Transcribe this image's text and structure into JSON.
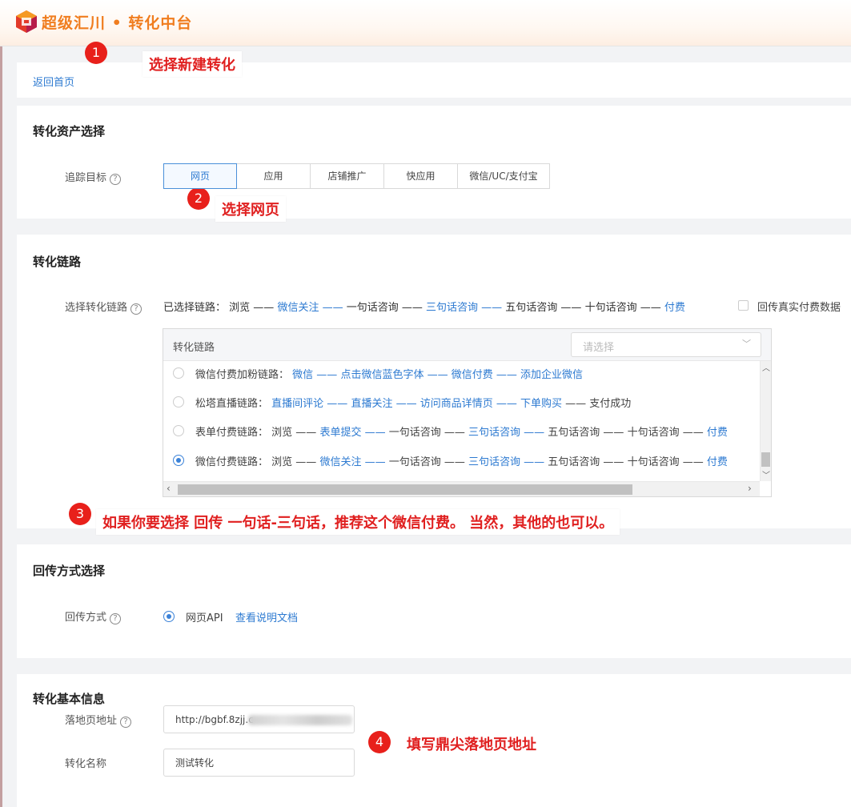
{
  "header": {
    "app_title": "超级汇川 • 转化中台"
  },
  "nav": {
    "back": "返回首页"
  },
  "asset": {
    "title": "转化资产选择",
    "track_label": "追踪目标",
    "help": "?",
    "options": [
      "网页",
      "应用",
      "店铺推广",
      "快应用",
      "微信/UC/支付宝"
    ],
    "selected": "网页"
  },
  "chain": {
    "title": "转化链路",
    "select_label": "选择转化链路",
    "help": "?",
    "selected_prefix": "已选择链路：",
    "selected_steps": [
      {
        "text": "浏览",
        "blue": false
      },
      {
        "text": " —— ",
        "blue": false
      },
      {
        "text": "微信关注",
        "blue": true
      },
      {
        "text": " —— ",
        "blue": true
      },
      {
        "text": "一句话咨询",
        "blue": false
      },
      {
        "text": " —— ",
        "blue": false
      },
      {
        "text": "三句话咨询",
        "blue": true
      },
      {
        "text": " —— ",
        "blue": true
      },
      {
        "text": "五句话咨询",
        "blue": false
      },
      {
        "text": " —— ",
        "blue": false
      },
      {
        "text": "十句话咨询",
        "blue": false
      },
      {
        "text": " —— ",
        "blue": false
      },
      {
        "text": "付费",
        "blue": true
      }
    ],
    "checkbox_label": "回传真实付费数据",
    "box_header": "转化链路",
    "select_placeholder": "请选择",
    "rows": [
      {
        "name": "微信付费加粉链路：",
        "checked": false,
        "steps": [
          {
            "text": "微信",
            "blue": true
          },
          {
            "text": " —— ",
            "blue": true
          },
          {
            "text": "点击微信蓝色字体",
            "blue": true
          },
          {
            "text": " —— ",
            "blue": true
          },
          {
            "text": "微信付费",
            "blue": true
          },
          {
            "text": " —— ",
            "blue": true
          },
          {
            "text": "添加企业微信",
            "blue": true
          }
        ]
      },
      {
        "name": "松塔直播链路：",
        "checked": false,
        "steps": [
          {
            "text": "直播间评论",
            "blue": true
          },
          {
            "text": " —— ",
            "blue": true
          },
          {
            "text": "直播关注",
            "blue": true
          },
          {
            "text": " —— ",
            "blue": true
          },
          {
            "text": "访问商品详情页",
            "blue": true
          },
          {
            "text": " —— ",
            "blue": true
          },
          {
            "text": "下单购买",
            "blue": true
          },
          {
            "text": " —— ",
            "blue": false
          },
          {
            "text": "支付成功",
            "blue": false
          }
        ]
      },
      {
        "name": "表单付费链路：",
        "checked": false,
        "steps": [
          {
            "text": "浏览",
            "blue": false
          },
          {
            "text": " —— ",
            "blue": false
          },
          {
            "text": "表单提交",
            "blue": true
          },
          {
            "text": " —— ",
            "blue": true
          },
          {
            "text": "一句话咨询",
            "blue": false
          },
          {
            "text": " —— ",
            "blue": false
          },
          {
            "text": "三句话咨询",
            "blue": true
          },
          {
            "text": " —— ",
            "blue": true
          },
          {
            "text": "五句话咨询",
            "blue": false
          },
          {
            "text": " —— ",
            "blue": false
          },
          {
            "text": "十句话咨询",
            "blue": false
          },
          {
            "text": " —— ",
            "blue": false
          },
          {
            "text": "付费",
            "blue": true
          }
        ]
      },
      {
        "name": "微信付费链路：",
        "checked": true,
        "steps": [
          {
            "text": "浏览",
            "blue": false
          },
          {
            "text": " —— ",
            "blue": false
          },
          {
            "text": "微信关注",
            "blue": true
          },
          {
            "text": " —— ",
            "blue": true
          },
          {
            "text": "一句话咨询",
            "blue": false
          },
          {
            "text": " —— ",
            "blue": false
          },
          {
            "text": "三句话咨询",
            "blue": true
          },
          {
            "text": " —— ",
            "blue": true
          },
          {
            "text": "五句话咨询",
            "blue": false
          },
          {
            "text": " —— ",
            "blue": false
          },
          {
            "text": "十句话咨询",
            "blue": false
          },
          {
            "text": " —— ",
            "blue": false
          },
          {
            "text": "付费",
            "blue": true
          }
        ]
      }
    ]
  },
  "method": {
    "title": "回传方式选择",
    "label": "回传方式",
    "help": "?",
    "option": "网页API",
    "doc_link": "查看说明文档"
  },
  "basic": {
    "title": "转化基本信息",
    "landing_label": "落地页地址",
    "help": "?",
    "landing_value": "http://bgbf.8zjj.c",
    "name_label": "转化名称",
    "name_value": "测试转化"
  },
  "annotations": [
    {
      "num": "1",
      "text": "选择新建转化"
    },
    {
      "num": "2",
      "text": "选择网页"
    },
    {
      "num": "3",
      "text": "如果你要选择 回传 一句话-三句话，推荐这个微信付费。 当然，其他的也可以。"
    },
    {
      "num": "4",
      "text": "填写鼎尖落地页地址"
    }
  ],
  "colors": {
    "brand": "#f07d1f",
    "link": "#2d7ad1",
    "annotation": "#e8201b"
  }
}
